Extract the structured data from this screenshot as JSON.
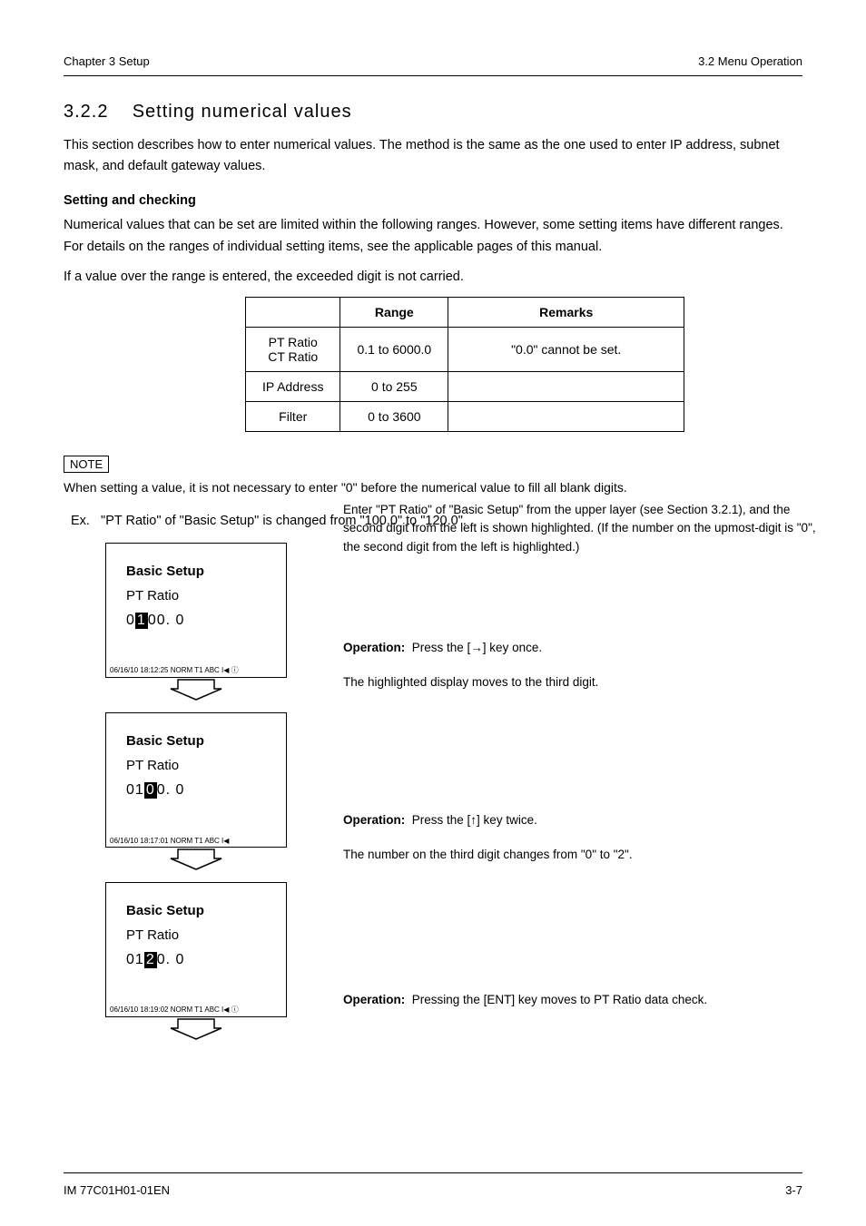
{
  "header": {
    "left": "Chapter 3 Setup",
    "right": "3.2 Menu Operation"
  },
  "section": {
    "number": "3.2.2",
    "title": "Setting numerical values"
  },
  "intro": "This section describes how to enter numerical values. The method is the same as the one used to enter IP address, subnet mask, and default gateway values.",
  "sub1": {
    "title": "Setting and checking",
    "para1": "Numerical values that can be set are limited within the following ranges. However, some setting items have different ranges. For details on the ranges of individual setting items, see the applicable pages of this manual.",
    "para2": "If a value over the range is entered, the exceeded digit is not carried."
  },
  "table": {
    "headers": [
      "",
      "Range",
      "Remarks"
    ],
    "rows": [
      [
        "PT Ratio\nCT Ratio",
        "0.1 to 6000.0",
        "\"0.0\" cannot be set."
      ],
      [
        "IP Address",
        "0 to 255",
        ""
      ],
      [
        "Filter",
        "0 to 3600",
        ""
      ]
    ]
  },
  "note": {
    "label": "NOTE",
    "text": "When setting a value, it is not necessary to enter \"0\" before the numerical value to fill all blank digits."
  },
  "example": {
    "label": "Ex.",
    "text": "\"PT Ratio\" of \"Basic Setup\" is changed from \"100.0\" to \"120.0\"."
  },
  "screens": {
    "s1": {
      "title": "Basic Setup",
      "field": "PT Ratio",
      "d0": "0",
      "d1": "1",
      "d2": "0",
      "d3": "0.",
      "d4": " 0",
      "status": "06/16/10 18:12:25  NORM T1 ABC  I◀ ⓘ"
    },
    "s2": {
      "title": "Basic Setup",
      "field": "PT Ratio",
      "d0": "0",
      "d1": "1",
      "d2": "0",
      "d3": "0.",
      "d4": " 0",
      "status": "06/16/10 18:17:01  NORM T1 ABC  I◀"
    },
    "s3": {
      "title": "Basic Setup",
      "field": "PT Ratio",
      "d0": "0",
      "d1": "1",
      "d2": "2",
      "d3": "0.",
      "d4": " 0",
      "status": "06/16/10 18:19:02  NORM T1 ABC  I◀ ⓘ"
    }
  },
  "captions": {
    "c1": "Enter \"PT Ratio\" of \"Basic Setup\" from the upper layer (see Section 3.2.1), and the second digit from the left is shown highlighted. (If the number on the upmost-digit is \"0\", the second digit from the left is highlighted.)",
    "c2_label": "Operation:",
    "c2": "Press the [→] key once.",
    "c3": "The highlighted display moves to the third digit.",
    "c4_label": "Operation:",
    "c4": "Press the [↑] key twice.",
    "c5": "The number on the third digit changes from \"0\" to \"2\".",
    "c6_label": "Operation:",
    "c6": "Pressing the [ENT] key moves to PT Ratio data check."
  },
  "footer": {
    "left": "IM 77C01H01-01EN",
    "right": "3-7"
  }
}
